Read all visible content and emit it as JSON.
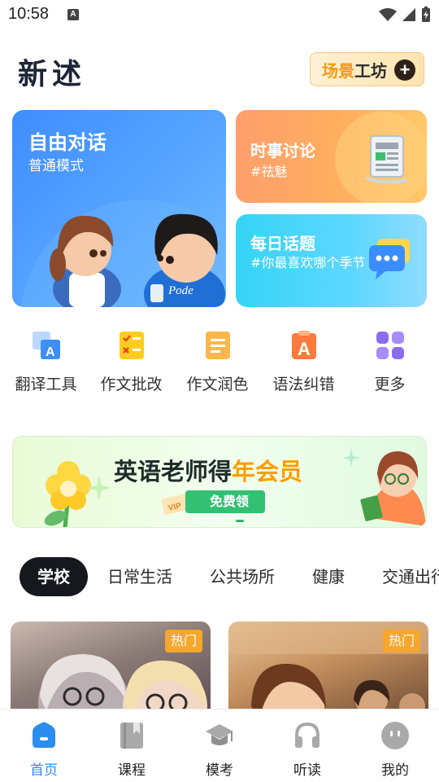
{
  "status_bar": {
    "time": "10:58",
    "notification_icon": "A"
  },
  "header": {
    "app_title": "新述",
    "scene_workshop": {
      "label_part1": "场景",
      "label_part2": "工坊",
      "icon": "plus-circle-icon"
    }
  },
  "cards": {
    "free_talk": {
      "title": "自由对话",
      "subtitle": "普通模式"
    },
    "news": {
      "title": "时事讨论",
      "subtitle": "#祛魅"
    },
    "daily_topic": {
      "title": "每日话题",
      "subtitle": "#你最喜欢哪个季节"
    }
  },
  "tools": [
    {
      "label": "翻译工具",
      "icon": "translate-icon"
    },
    {
      "label": "作文批改",
      "icon": "essay-correct-icon"
    },
    {
      "label": "作文润色",
      "icon": "essay-polish-icon"
    },
    {
      "label": "语法纠错",
      "icon": "grammar-icon"
    },
    {
      "label": "更多",
      "icon": "more-grid-icon"
    }
  ],
  "banner": {
    "headline_main": "英语老师得",
    "headline_highlight": "年会员",
    "button": "免费领",
    "vip": "VIP"
  },
  "category_tabs": [
    "学校",
    "日常生活",
    "公共场所",
    "健康",
    "交通出行"
  ],
  "scenario_cards": [
    {
      "badge": "热门"
    },
    {
      "badge": "热门"
    }
  ],
  "bottom_nav": [
    {
      "label": "首页",
      "icon": "home-icon",
      "active": true
    },
    {
      "label": "课程",
      "icon": "book-icon",
      "active": false
    },
    {
      "label": "模考",
      "icon": "graduation-cap-icon",
      "active": false
    },
    {
      "label": "听读",
      "icon": "headphones-icon",
      "active": false
    },
    {
      "label": "我的",
      "icon": "profile-icon",
      "active": false
    }
  ],
  "colors": {
    "accent": "#2d8cf0",
    "hot_badge": "#f6a72b",
    "banner_button": "#33c072"
  }
}
